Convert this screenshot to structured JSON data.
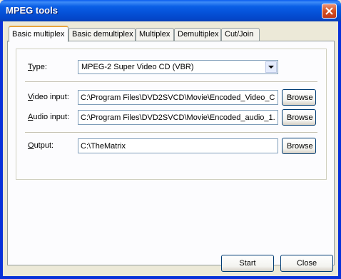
{
  "window": {
    "title": "MPEG tools"
  },
  "tabs": [
    {
      "label": "Basic multiplex",
      "active": true
    },
    {
      "label": "Basic demultiplex"
    },
    {
      "label": "Multiplex"
    },
    {
      "label": "Demultiplex"
    },
    {
      "label": "Cut/Join"
    }
  ],
  "form": {
    "type": {
      "label_u": "T",
      "label_rest": "ype:",
      "value": "MPEG-2 Super Video CD (VBR)"
    },
    "video": {
      "label_u": "V",
      "label_rest": "ideo input:",
      "value": "C:\\Program Files\\DVD2SVCD\\Movie\\Encoded_Video_C",
      "browse": "Browse"
    },
    "audio": {
      "label_u": "A",
      "label_rest": "udio input:",
      "value": "C:\\Program Files\\DVD2SVCD\\Movie\\Encoded_audio_1.",
      "browse": "Browse"
    },
    "output": {
      "label_u": "O",
      "label_rest": "utput:",
      "value": "C:\\TheMatrix",
      "browse": "Browse"
    }
  },
  "buttons": {
    "start": "Start",
    "close": "Close"
  }
}
